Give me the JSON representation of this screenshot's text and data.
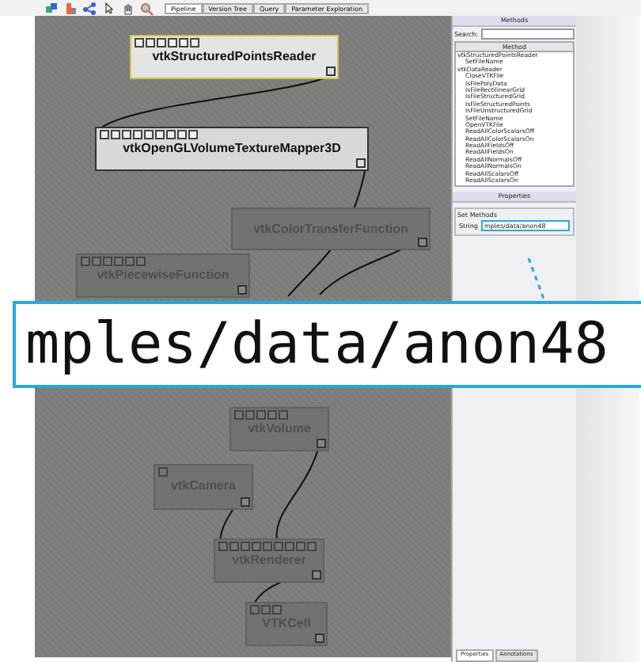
{
  "toolbar": {
    "tabs": [
      {
        "label": "Pipeline",
        "selected": true
      },
      {
        "label": "Version Tree",
        "selected": false
      },
      {
        "label": "Query",
        "selected": false
      },
      {
        "label": "Parameter Exploration",
        "selected": false
      }
    ]
  },
  "pipeline": {
    "modules": [
      {
        "name": "vtkStructuredPointsReader",
        "selected": true,
        "dimmed": false
      },
      {
        "name": "vtkOpenGLVolumeTextureMapper3D",
        "selected": false,
        "dimmed": false
      },
      {
        "name": "vtkColorTransferFunction",
        "selected": false,
        "dimmed": true
      },
      {
        "name": "vtkPiecewiseFunction",
        "selected": false,
        "dimmed": true
      },
      {
        "name": "vtkVolume",
        "selected": false,
        "dimmed": true
      },
      {
        "name": "vtkCamera",
        "selected": false,
        "dimmed": true
      },
      {
        "name": "vtkRenderer",
        "selected": false,
        "dimmed": true
      },
      {
        "name": "VTKCell",
        "selected": false,
        "dimmed": true
      }
    ]
  },
  "methods_panel": {
    "title": "Methods",
    "search_label": "Search:",
    "column": "Method",
    "items": [
      {
        "label": "vtkStructuredPointsReader",
        "children": [
          {
            "label": "SetFileName"
          }
        ]
      },
      {
        "label": "vtkDataReader",
        "children": [
          {
            "label": "CloseVTKFile"
          },
          {
            "label": "IsFilePolyData"
          },
          {
            "label": "IsFileRectilinearGrid"
          },
          {
            "label": "IsFileStructuredGrid"
          },
          {
            "label": "IsFileStructuredPoints"
          },
          {
            "label": "IsFileUnstructuredGrid"
          },
          {
            "label": "SetFileName"
          },
          {
            "label": "OpenVTKFile"
          },
          {
            "label": "ReadAllColorScalarsOff"
          },
          {
            "label": "ReadAllColorScalarsOn"
          },
          {
            "label": "ReadAllFieldsOff"
          },
          {
            "label": "ReadAllFieldsOn"
          },
          {
            "label": "ReadAllNormalsOff"
          },
          {
            "label": "ReadAllNormalsOn"
          },
          {
            "label": "ReadAllScalarsOff"
          },
          {
            "label": "ReadAllScalarsOn"
          }
        ]
      }
    ]
  },
  "properties_panel": {
    "title": "Properties",
    "group": "Set Methods",
    "field_label": "String",
    "field_value": "mples/data/anon48"
  },
  "bottom_tabs": [
    {
      "label": "Properties",
      "selected": true
    },
    {
      "label": "Annotations",
      "selected": false
    }
  ],
  "callout": {
    "text": "mples/data/anon48"
  }
}
